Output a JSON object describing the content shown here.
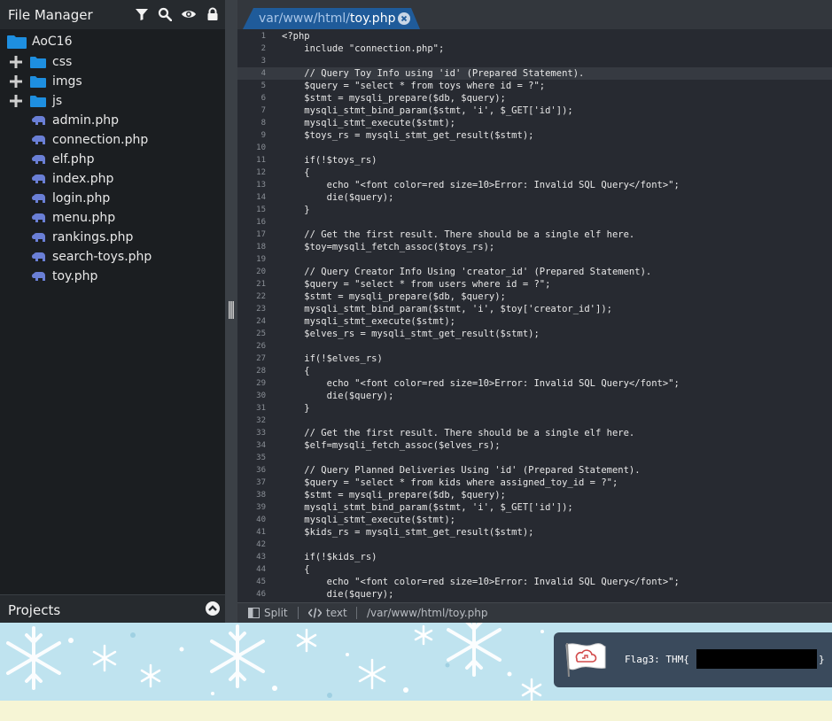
{
  "sidebar": {
    "title": "File Manager",
    "tools": [
      "filter-icon",
      "search-icon",
      "eye-icon",
      "lock-icon"
    ],
    "root": "AoC16",
    "folders": [
      "css",
      "imgs",
      "js"
    ],
    "files": [
      "admin.php",
      "connection.php",
      "elf.php",
      "index.php",
      "login.php",
      "menu.php",
      "rankings.php",
      "search-toys.php",
      "toy.php"
    ],
    "footer_title": "Projects"
  },
  "editor": {
    "tab_path": "var/www/html/",
    "tab_file": "toy.php",
    "highlighted_line": 4,
    "lines": [
      "<?php",
      "    include \"connection.php\";",
      "",
      "    // Query Toy Info using 'id' (Prepared Statement).",
      "    $query = \"select * from toys where id = ?\";",
      "    $stmt = mysqli_prepare($db, $query);",
      "    mysqli_stmt_bind_param($stmt, 'i', $_GET['id']);",
      "    mysqli_stmt_execute($stmt);",
      "    $toys_rs = mysqli_stmt_get_result($stmt);",
      "",
      "    if(!$toys_rs)",
      "    {",
      "        echo \"<font color=red size=10>Error: Invalid SQL Query</font>\";",
      "        die($query);",
      "    }",
      "",
      "    // Get the first result. There should be a single elf here.",
      "    $toy=mysqli_fetch_assoc($toys_rs);",
      "",
      "    // Query Creator Info Using 'creator_id' (Prepared Statement).",
      "    $query = \"select * from users where id = ?\";",
      "    $stmt = mysqli_prepare($db, $query);",
      "    mysqli_stmt_bind_param($stmt, 'i', $toy['creator_id']);",
      "    mysqli_stmt_execute($stmt);",
      "    $elves_rs = mysqli_stmt_get_result($stmt);",
      "",
      "    if(!$elves_rs)",
      "    {",
      "        echo \"<font color=red size=10>Error: Invalid SQL Query</font>\";",
      "        die($query);",
      "    }",
      "",
      "    // Get the first result. There should be a single elf here.",
      "    $elf=mysqli_fetch_assoc($elves_rs);",
      "",
      "    // Query Planned Deliveries Using 'id' (Prepared Statement).",
      "    $query = \"select * from kids where assigned_toy_id = ?\";",
      "    $stmt = mysqli_prepare($db, $query);",
      "    mysqli_stmt_bind_param($stmt, 'i', $_GET['id']);",
      "    mysqli_stmt_execute($stmt);",
      "    $kids_rs = mysqli_stmt_get_result($stmt);",
      "",
      "    if(!$kids_rs)",
      "    {",
      "        echo \"<font color=red size=10>Error: Invalid SQL Query</font>\";",
      "        die($query);"
    ]
  },
  "status": {
    "split_label": "Split",
    "mode_label": "text",
    "path": "/var/www/html/toy.php"
  },
  "notification": {
    "prefix": "Flag3: THM{",
    "suffix": "}"
  },
  "colors": {
    "folder": "#1e8fe0",
    "php_icon": "#6a7fd6",
    "tab": "#1f5b9a",
    "tab_file": "#ffffff"
  }
}
